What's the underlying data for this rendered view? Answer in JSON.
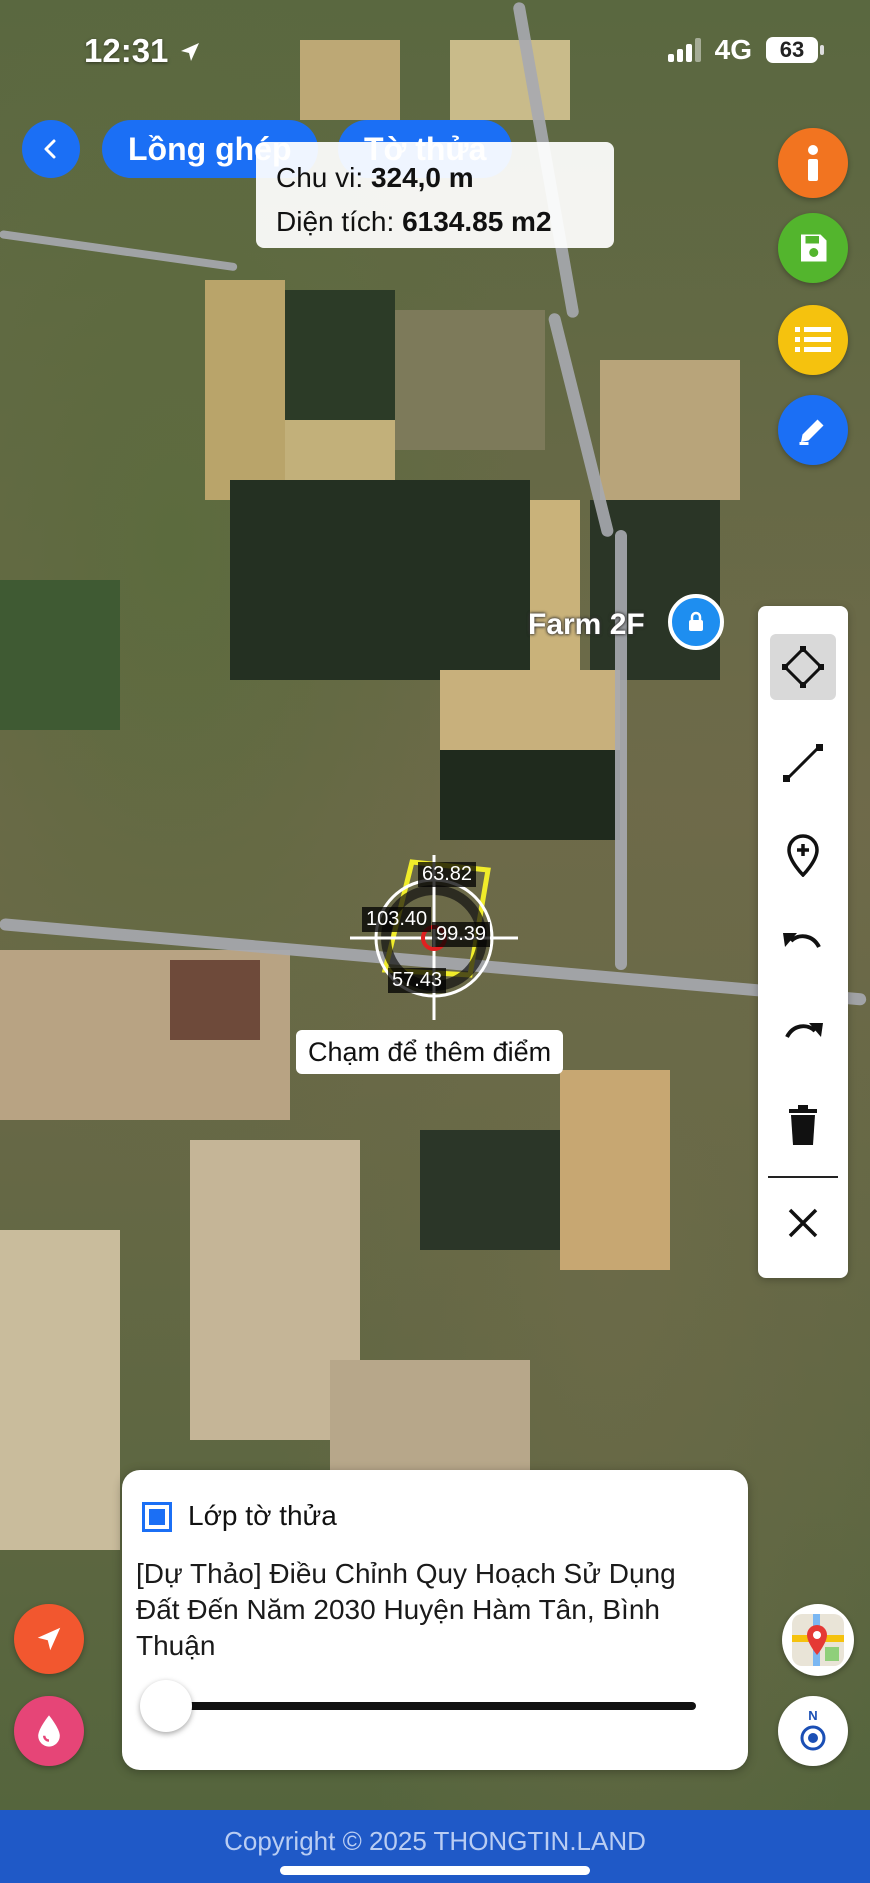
{
  "status_bar": {
    "time": "12:31",
    "network": "4G",
    "battery": "63"
  },
  "top_bar": {
    "tab_merge": "Lồng ghép",
    "tab_parcel": "Tờ thửa"
  },
  "measure": {
    "perimeter_label": "Chu vi:",
    "perimeter_value": "324,0 m",
    "area_label": "Diện tích:",
    "area_value": "6134.85 m2"
  },
  "map": {
    "poi_label": "Farm 2F",
    "segment_labels": [
      "63.82",
      "103.40",
      "99.39",
      "57.43"
    ],
    "hint": "Chạm để thêm điểm"
  },
  "layer_card": {
    "title": "Lớp tờ thửa",
    "checked": true,
    "description": "[Dự Thảo] Điều Chỉnh Quy Hoạch Sử Dụng Đất Đến Năm 2030 Huyện Hàm Tân, Bình Thuận",
    "opacity": 0
  },
  "compass_label": "N",
  "footer": {
    "copyright": "Copyright © 2025 THONGTIN.LAND"
  },
  "colors": {
    "primary": "#1b6ff5",
    "info": "#f27420",
    "save": "#53b52d",
    "list": "#f5c20e",
    "edit": "#1b6ff5",
    "location": "#f2572f",
    "drop": "#e64577",
    "footer": "#1f59c7"
  },
  "icons": {
    "info": "info-icon",
    "save": "save-icon",
    "list": "list-icon",
    "edit": "edit-icon",
    "polygon": "polygon-icon",
    "line": "line-icon",
    "add_point": "add-point-icon",
    "undo": "undo-icon",
    "redo": "redo-icon",
    "delete": "trash-icon",
    "close": "close-icon"
  }
}
